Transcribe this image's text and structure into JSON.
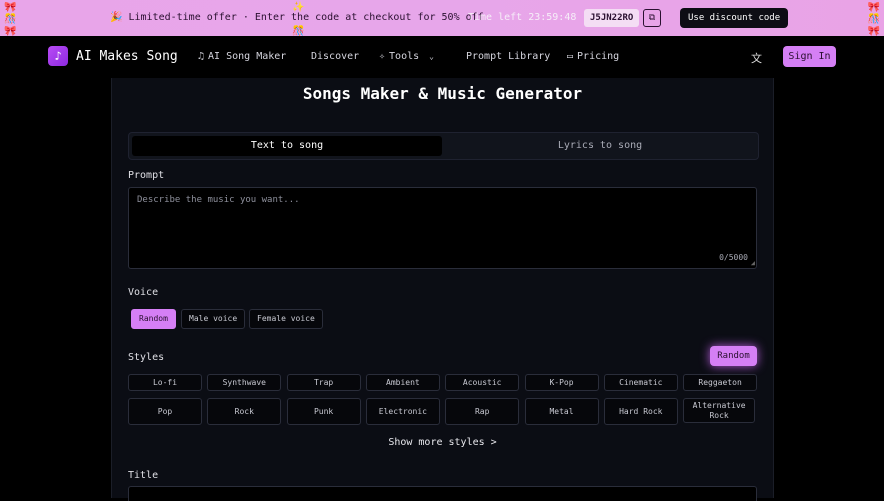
{
  "banner": {
    "offer_text": "🎉 Limited-time offer · Enter the code at checkout for 50% off",
    "timer_text": "Time left 23:59:48",
    "code": "J5JN22RO",
    "use_button": "Use discount code"
  },
  "nav": {
    "brand": "AI Makes Song",
    "items": [
      "AI Song Maker",
      "Discover",
      "Tools",
      "Prompt Library",
      "Pricing"
    ],
    "sign_in": "Sign In"
  },
  "main": {
    "title": "Songs Maker & Music Generator",
    "tabs": [
      "Text to song",
      "Lyrics to song"
    ],
    "prompt_label": "Prompt",
    "prompt_placeholder": "Describe the music you want...",
    "char_count": "0/5000",
    "voice_label": "Voice",
    "voices": [
      "Random",
      "Male voice",
      "Female voice"
    ],
    "styles_label": "Styles",
    "random_button": "Random",
    "styles_row1": [
      "Lo-fi",
      "Synthwave",
      "Trap",
      "Ambient",
      "Acoustic",
      "K-Pop",
      "Cinematic",
      "Reggaeton"
    ],
    "styles_row2": [
      "Pop",
      "Rock",
      "Punk",
      "Electronic",
      "Rap",
      "Metal",
      "Hard Rock",
      "Alternative Rock"
    ],
    "show_more": "Show more styles >",
    "title_label": "Title"
  },
  "colors": {
    "accent": "#d57ff5",
    "banner": "#e8a5e9",
    "background": "#000000",
    "card": "#0b0d14"
  }
}
